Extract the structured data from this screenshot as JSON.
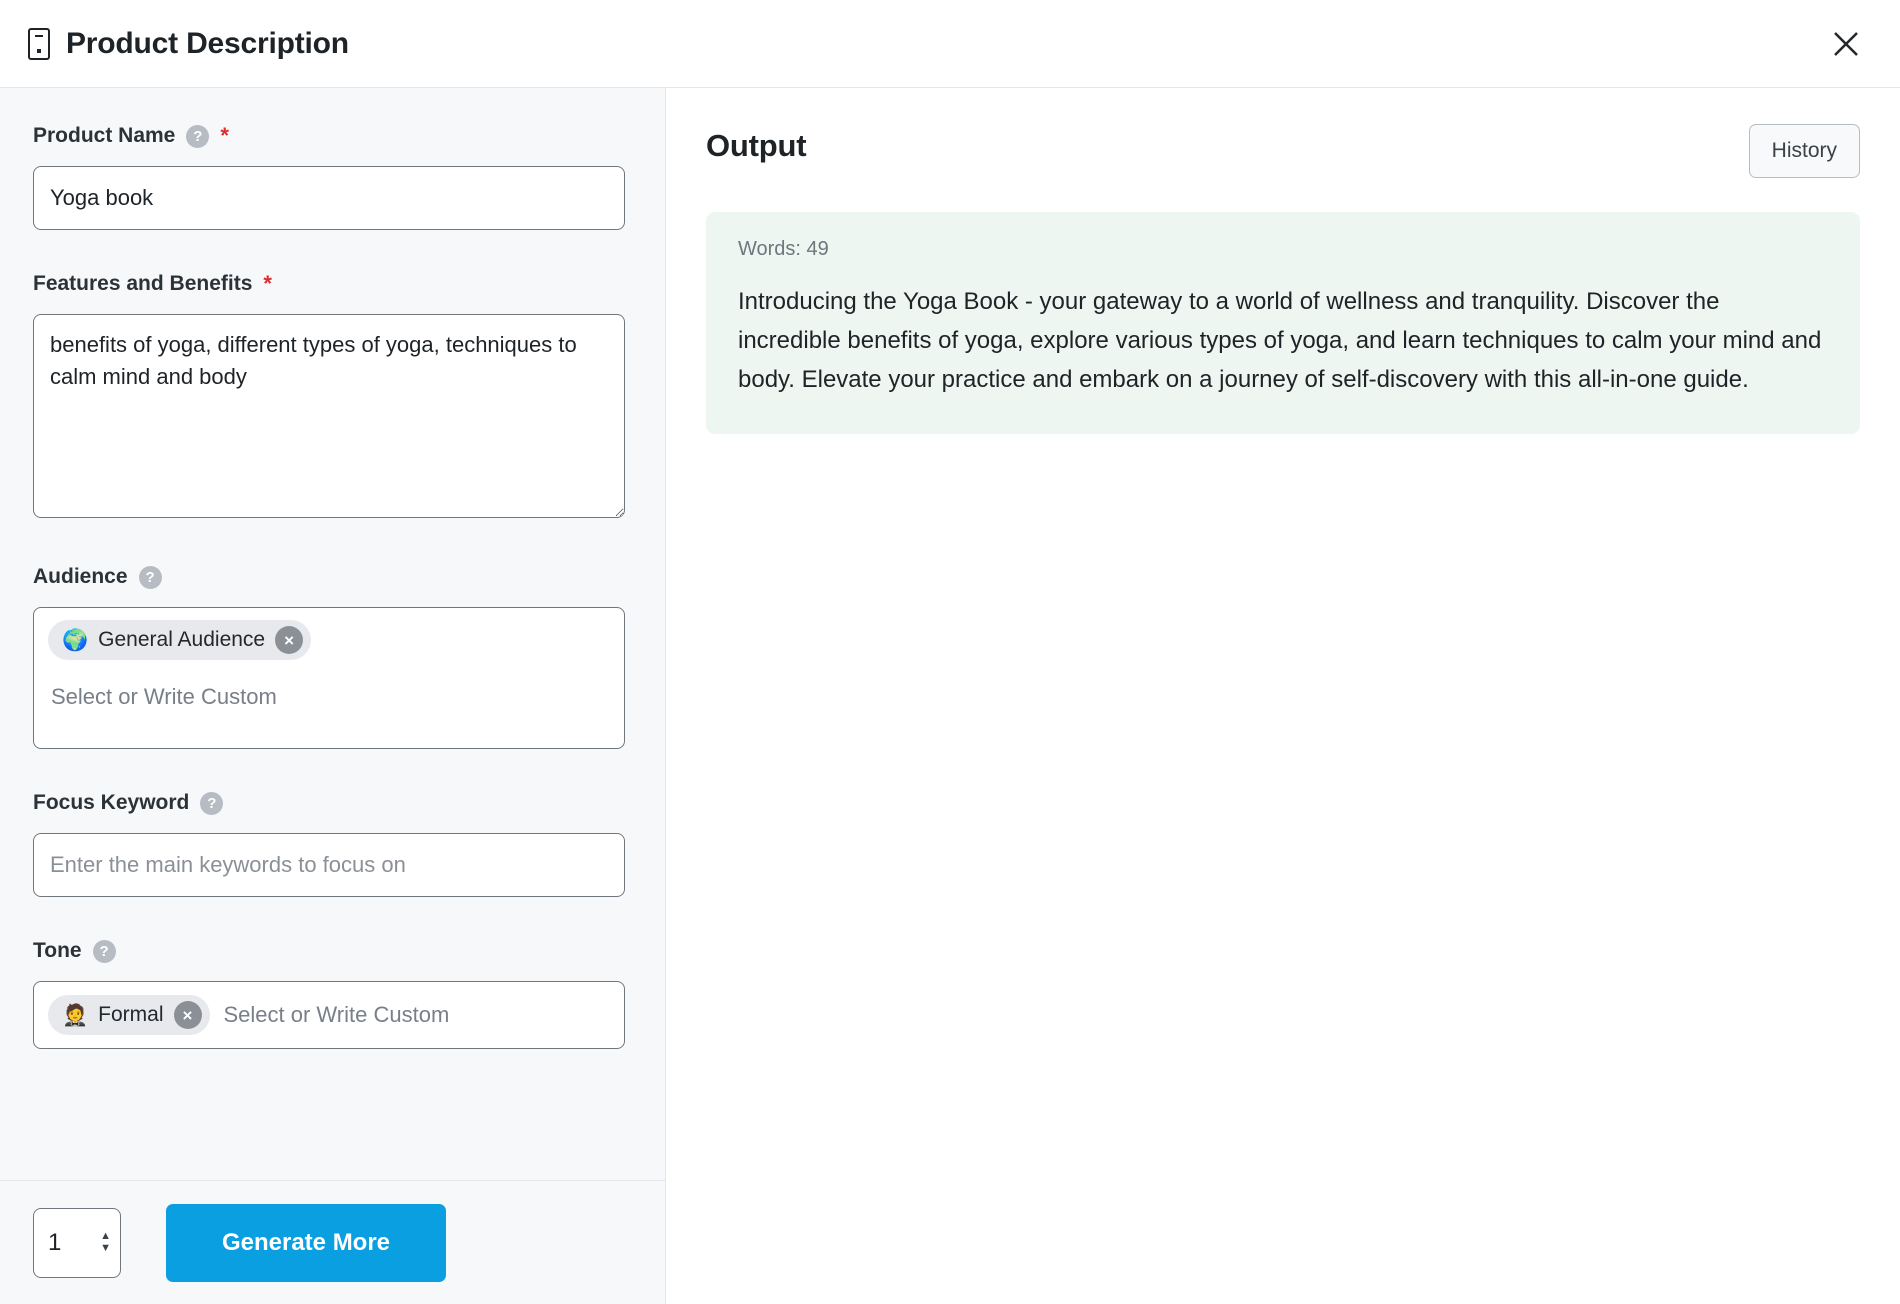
{
  "header": {
    "icon": "device-document-icon",
    "title": "Product Description",
    "close_label": "close-icon"
  },
  "form": {
    "product_name": {
      "label": "Product Name",
      "help": "?",
      "required": "*",
      "value": "Yoga book"
    },
    "features_benefits": {
      "label": "Features and Benefits",
      "required": "*",
      "value": "benefits of yoga, different types of yoga, techniques to calm mind and body"
    },
    "audience": {
      "label": "Audience",
      "help": "?",
      "chips": [
        {
          "emoji": "🌍",
          "label": "General Audience",
          "remove": "×"
        }
      ],
      "placeholder": "Select or Write Custom"
    },
    "focus_keyword": {
      "label": "Focus Keyword",
      "help": "?",
      "value": "",
      "placeholder": "Enter the main keywords to focus on"
    },
    "tone": {
      "label": "Tone",
      "help": "?",
      "chips": [
        {
          "emoji": "🤵",
          "label": "Formal",
          "remove": "×"
        }
      ],
      "placeholder": "Select or Write Custom"
    }
  },
  "footer": {
    "count_value": "1",
    "stepper_up": "▲",
    "stepper_down": "▼",
    "generate_label": "Generate More"
  },
  "output": {
    "title": "Output",
    "history_label": "History",
    "words_label": "Words: 49",
    "text": "Introducing the Yoga Book - your gateway to a world of wellness and tranquility. Discover the incredible benefits of yoga, explore various types of yoga, and learn techniques to calm your mind and body. Elevate your practice and embark on a journey of self-discovery with this all-in-one guide."
  },
  "colors": {
    "accent": "#0a9fe0",
    "required": "#e02b2b",
    "panel_bg": "#f7f8fa",
    "output_card_bg": "#eef6f1",
    "border": "#6f767e"
  }
}
